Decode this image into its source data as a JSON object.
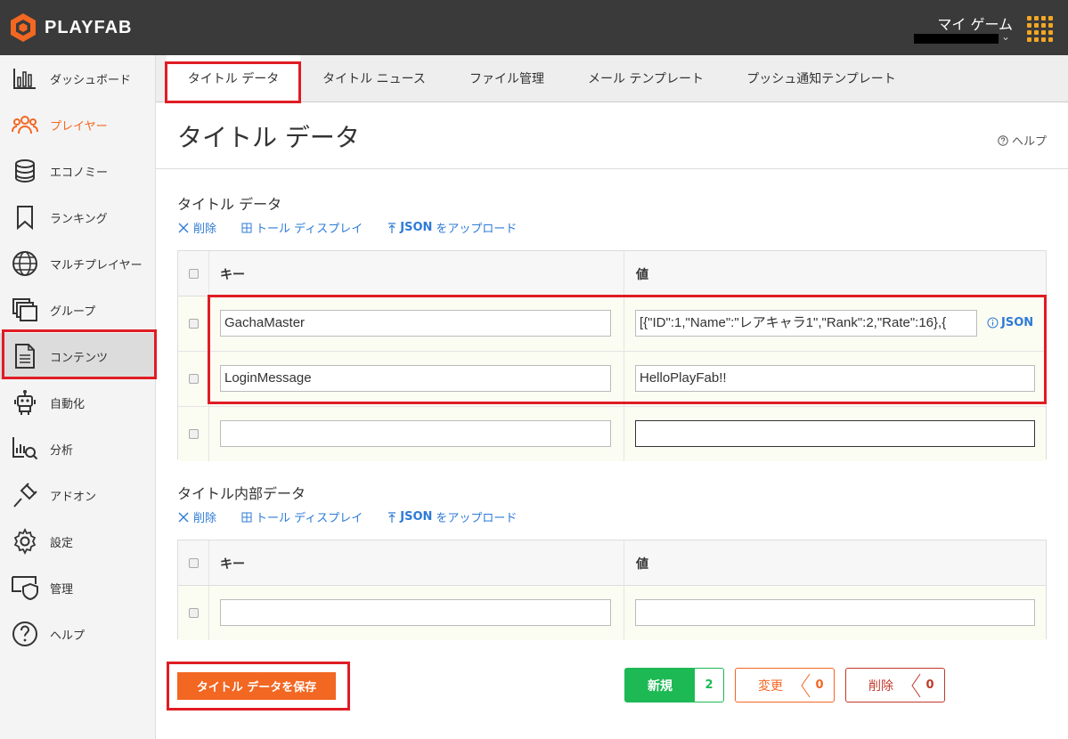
{
  "app": {
    "name": "PLAYFAB",
    "game_title": "マイ ゲーム"
  },
  "sidebar": {
    "items": [
      {
        "label": "ダッシュボード",
        "icon": "bar-chart-icon"
      },
      {
        "label": "プレイヤー",
        "icon": "players-icon"
      },
      {
        "label": "エコノミー",
        "icon": "coins-icon"
      },
      {
        "label": "ランキング",
        "icon": "bookmark-icon"
      },
      {
        "label": "マルチプレイヤー",
        "icon": "globe-icon"
      },
      {
        "label": "グループ",
        "icon": "layers-icon"
      },
      {
        "label": "コンテンツ",
        "icon": "document-icon"
      },
      {
        "label": "自動化",
        "icon": "robot-icon"
      },
      {
        "label": "分析",
        "icon": "analytics-icon"
      },
      {
        "label": "アドオン",
        "icon": "plug-icon"
      },
      {
        "label": "設定",
        "icon": "gear-icon"
      },
      {
        "label": "管理",
        "icon": "shield-icon"
      },
      {
        "label": "ヘルプ",
        "icon": "question-icon"
      }
    ]
  },
  "tabs": [
    {
      "label": "タイトル データ"
    },
    {
      "label": "タイトル ニュース"
    },
    {
      "label": "ファイル管理"
    },
    {
      "label": "メール テンプレート"
    },
    {
      "label": "プッシュ通知テンプレート"
    }
  ],
  "page": {
    "title": "タイトル データ",
    "help": "ヘルプ"
  },
  "title_data": {
    "section_title": "タイトル データ",
    "actions": {
      "delete": "削除",
      "toggle": "トール ディスプレイ",
      "upload_json": "JSON",
      "upload_suffix": "をアップロード"
    },
    "headers": {
      "key": "キー",
      "value": "値"
    },
    "rows": [
      {
        "key": "GachaMaster",
        "value": "[{\"ID\":1,\"Name\":\"レアキャラ1\",\"Rank\":2,\"Rate\":16},{",
        "json_link": "JSON"
      },
      {
        "key": "LoginMessage",
        "value": "HelloPlayFab!!"
      },
      {
        "key": "",
        "value": ""
      }
    ]
  },
  "internal_data": {
    "section_title": "タイトル内部データ",
    "actions": {
      "delete": "削除",
      "toggle": "トール ディスプレイ",
      "upload_json": "JSON",
      "upload_suffix": "をアップロード"
    },
    "headers": {
      "key": "キー",
      "value": "値"
    },
    "rows": [
      {
        "key": "",
        "value": ""
      }
    ]
  },
  "footer": {
    "save_label": "タイトル データを保存",
    "new_label": "新規",
    "new_count": "2",
    "changed_label": "変更",
    "changed_count": "0",
    "deleted_label": "削除",
    "deleted_count": "0"
  },
  "colors": {
    "accent": "#f26722",
    "link": "#2e7bd6",
    "success": "#1db954",
    "danger": "#c0392b",
    "highlight": "#e01c24"
  }
}
